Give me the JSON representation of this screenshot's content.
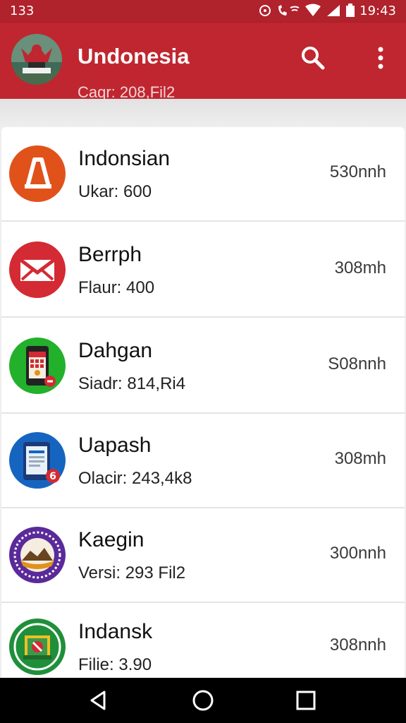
{
  "status_bar": {
    "left_text": "133",
    "time": "19:43"
  },
  "app_bar": {
    "title": "Undonesia",
    "subtitle": "Caqr: 208,Fil2",
    "search_icon": "search-icon",
    "more_icon": "more-vert-icon"
  },
  "items": [
    {
      "name": "Indonsian",
      "meta": "Ukar: 600",
      "right": "530nnh",
      "icon": "warning-triangle-icon",
      "color": "#e0521a"
    },
    {
      "name": "Berrph",
      "meta": "Flaur: 400",
      "right": "308mh",
      "icon": "mail-icon",
      "color": "#d42a33"
    },
    {
      "name": "Dahgan",
      "meta": "Siadr: 814,Ri4",
      "right": "S08nnh",
      "icon": "phone-calendar-icon",
      "color": "#23b02b"
    },
    {
      "name": "Uapash",
      "meta": "Olacir: 243,4k8",
      "right": "308mh",
      "icon": "tablet-icon",
      "color": "#1565c0"
    },
    {
      "name": "Kaegin",
      "meta": "Versi: 293 Fil2",
      "right": "300nnh",
      "icon": "mountain-badge-icon",
      "color": "#5a2a9a"
    },
    {
      "name": "Indansk",
      "meta": "Filie: 3.90",
      "right": "308nnh",
      "icon": "map-badge-icon",
      "color": "#1f8f3a"
    }
  ],
  "nav": {
    "back": "back-icon",
    "home": "home-icon",
    "recents": "recents-icon"
  },
  "colors": {
    "primary": "#c0262f",
    "status": "#b0222c"
  }
}
